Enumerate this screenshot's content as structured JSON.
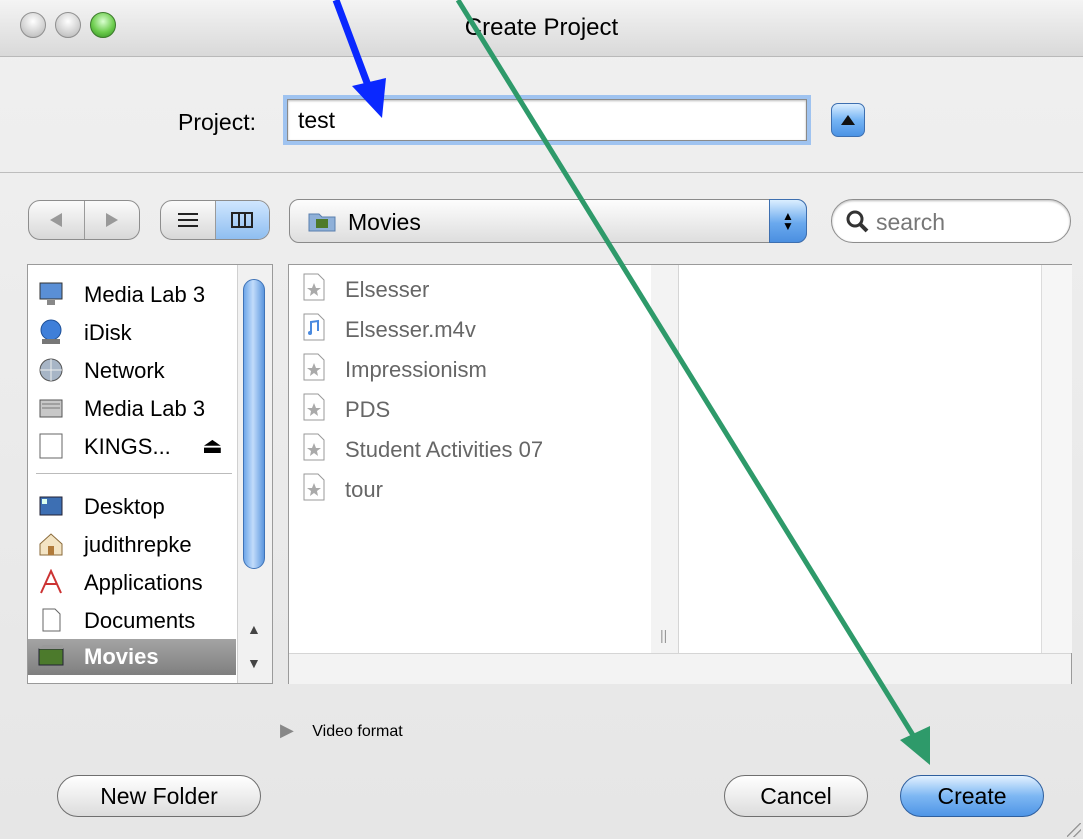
{
  "window": {
    "title": "Create Project"
  },
  "project": {
    "label": "Project:",
    "value": "test"
  },
  "toolbar": {
    "location": "Movies",
    "search_placeholder": "search",
    "back_icon": "triangle-left",
    "forward_icon": "triangle-right",
    "list_view_icon": "list-lines",
    "column_view_icon": "columns"
  },
  "sidebar": {
    "devices": [
      {
        "label": "Media Lab 3",
        "icon": "monitor-icon"
      },
      {
        "label": "iDisk",
        "icon": "idisk-icon"
      },
      {
        "label": "Network",
        "icon": "globe-icon"
      },
      {
        "label": "Media Lab 3",
        "icon": "harddisk-icon"
      },
      {
        "label": "KINGS...",
        "icon": "drive-icon",
        "eject": "⏏"
      }
    ],
    "places": [
      {
        "label": "Desktop",
        "icon": "desktop-icon"
      },
      {
        "label": "judithrepke",
        "icon": "home-icon"
      },
      {
        "label": "Applications",
        "icon": "applications-icon"
      },
      {
        "label": "Documents",
        "icon": "document-icon"
      },
      {
        "label": "Movies",
        "icon": "movies-icon",
        "selected": true
      }
    ]
  },
  "files": [
    {
      "label": "Elsesser",
      "icon": "project-file-icon"
    },
    {
      "label": "Elsesser.m4v",
      "icon": "music-file-icon"
    },
    {
      "label": "Impressionism",
      "icon": "project-file-icon"
    },
    {
      "label": "PDS",
      "icon": "project-file-icon"
    },
    {
      "label": "Student Activities 07",
      "icon": "project-file-icon"
    },
    {
      "label": "tour",
      "icon": "project-file-icon"
    }
  ],
  "disclosure": {
    "label": "Video format"
  },
  "buttons": {
    "new_folder": "New Folder",
    "cancel": "Cancel",
    "create": "Create"
  },
  "colors": {
    "accent_blue": "#4b93e4",
    "annotation_blue": "#0a28ff",
    "annotation_green": "#2e9a6a"
  }
}
